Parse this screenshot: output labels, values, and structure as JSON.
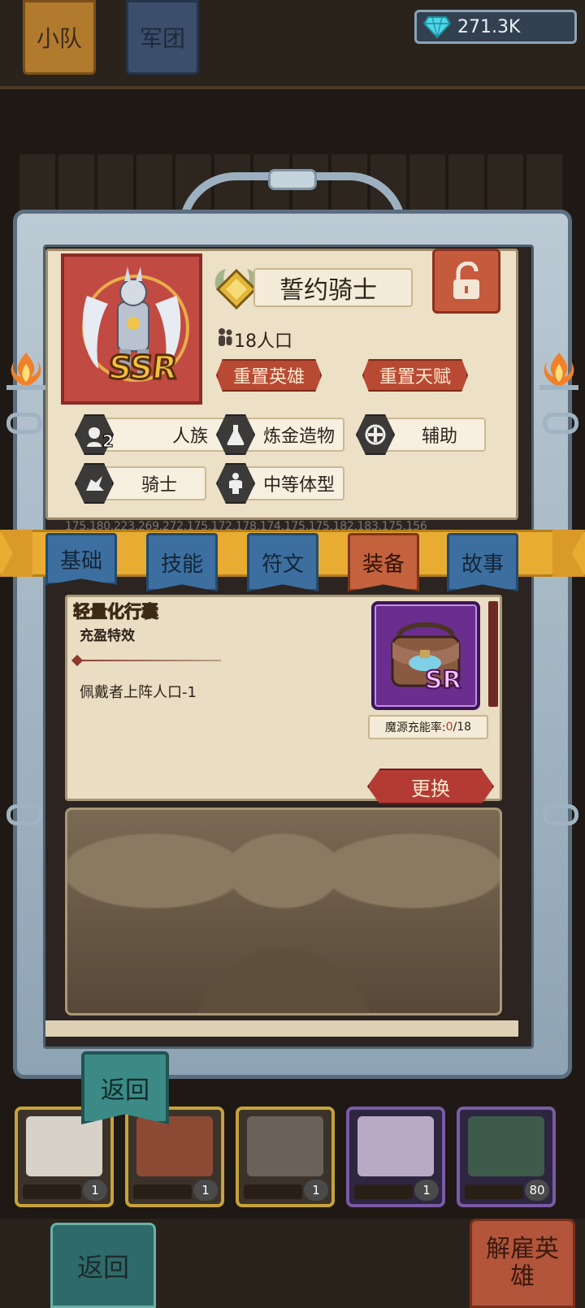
{
  "top": {
    "tabs": [
      "小队",
      "军团"
    ],
    "gems": "271.3K"
  },
  "hero": {
    "rarity": "SSR",
    "name": "誓约骑士",
    "population": "18人口",
    "reset_hero": "重置英雄",
    "reset_talent": "重置天赋",
    "traits": [
      {
        "label": "人族",
        "icon": "human-icon",
        "count": "2"
      },
      {
        "label": "炼金造物",
        "icon": "flask-icon"
      },
      {
        "label": "辅助",
        "icon": "support-cross-icon"
      },
      {
        "label": "骑士",
        "icon": "knight-icon"
      },
      {
        "label": "中等体型",
        "icon": "body-size-icon"
      }
    ]
  },
  "debug_numbers": "175,180,223,269,272,175,172,178,174,175,175,182,183,175,156",
  "tabs": [
    {
      "label": "基础"
    },
    {
      "label": "技能"
    },
    {
      "label": "符文"
    },
    {
      "label": "装备",
      "active": true
    },
    {
      "label": "故事"
    }
  ],
  "equipment": {
    "name": "轻量化行囊",
    "effect_title": "充盈特效",
    "description": "佩戴者上阵人口-1",
    "rarity": "SR",
    "charge_label": "魔源充能率:",
    "charge_current": "0",
    "charge_total": "/18",
    "replace_label": "更换"
  },
  "back_label": "返回",
  "bottom": {
    "back_label": "返回",
    "dismiss_label": "解雇英雄",
    "card_counts": [
      "1",
      "1",
      "1",
      "1",
      "80"
    ]
  },
  "colors": {
    "ribbon": "#e8ac32",
    "tab_inactive": "#3c6fa0",
    "tab_active": "#c4623e",
    "parchment": "#ece0c6",
    "red_button": "#b84a34"
  }
}
